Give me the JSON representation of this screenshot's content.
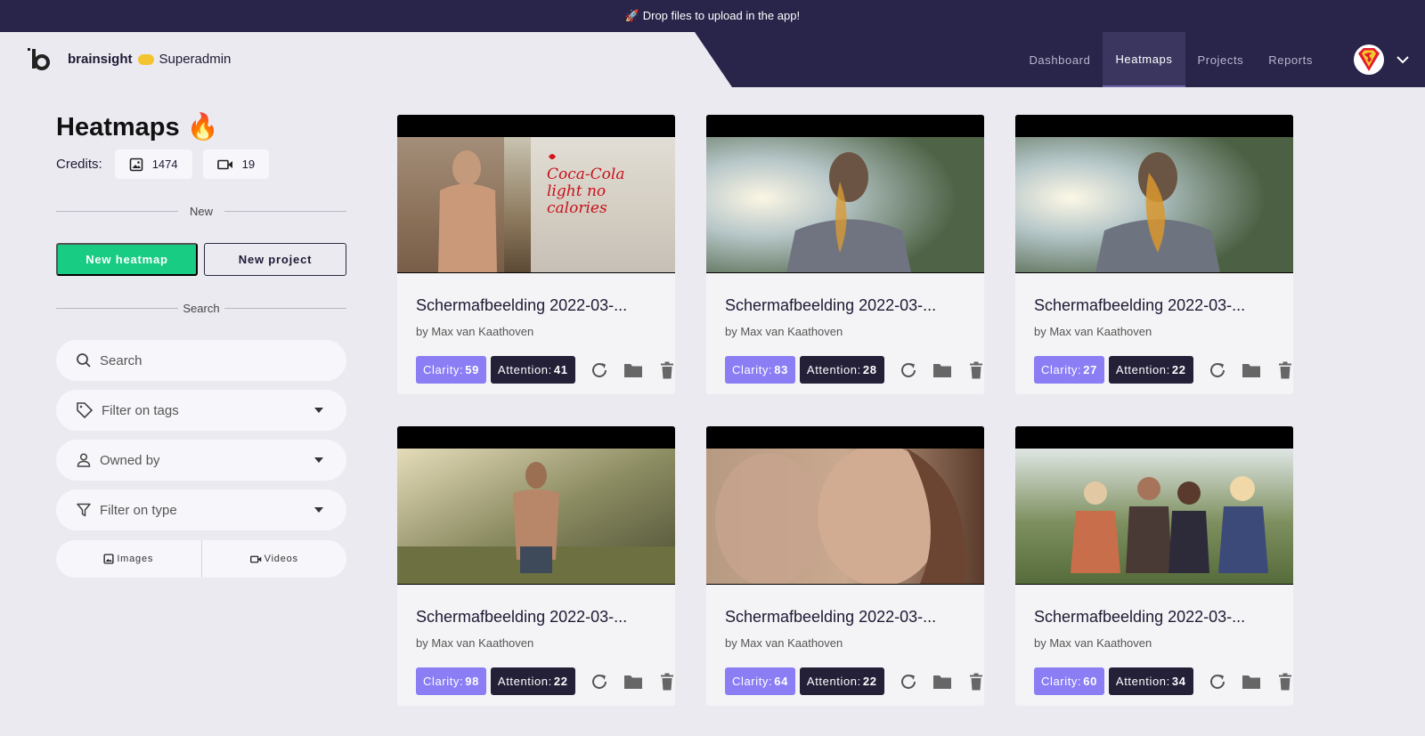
{
  "banner": {
    "text": "🚀 Drop files to upload in the app!"
  },
  "brand": {
    "name": "brainsight",
    "role": "Superadmin"
  },
  "nav": [
    {
      "label": "Dashboard",
      "active": false
    },
    {
      "label": "Heatmaps",
      "active": true
    },
    {
      "label": "Projects",
      "active": false
    },
    {
      "label": "Reports",
      "active": false
    }
  ],
  "sidebar": {
    "title": "Heatmaps",
    "title_emoji": "🔥",
    "credits_label": "Credits:",
    "image_credits": "1474",
    "video_credits": "19",
    "new_divider": "New",
    "new_heatmap_label": "New heatmap",
    "new_project_label": "New project",
    "search_divider": "Search",
    "search_placeholder": "Search",
    "filter_tags": "Filter on tags",
    "owned_by": "Owned by",
    "filter_type": "Filter on type",
    "toggle_images": "Images",
    "toggle_videos": "Videos"
  },
  "cards": [
    {
      "title": "Schermafbeelding 2022-03-...",
      "author": "by Max van Kaathoven",
      "clarity_label": "Clarity:",
      "clarity": "59",
      "attention_label": "Attention:",
      "attention": "41",
      "thumb_caption": "Coca-Cola light no calories"
    },
    {
      "title": "Schermafbeelding 2022-03-...",
      "author": "by Max van Kaathoven",
      "clarity_label": "Clarity:",
      "clarity": "83",
      "attention_label": "Attention:",
      "attention": "28"
    },
    {
      "title": "Schermafbeelding 2022-03-...",
      "author": "by Max van Kaathoven",
      "clarity_label": "Clarity:",
      "clarity": "27",
      "attention_label": "Attention:",
      "attention": "22"
    },
    {
      "title": "Schermafbeelding 2022-03-...",
      "author": "by Max van Kaathoven",
      "clarity_label": "Clarity:",
      "clarity": "98",
      "attention_label": "Attention:",
      "attention": "22"
    },
    {
      "title": "Schermafbeelding 2022-03-...",
      "author": "by Max van Kaathoven",
      "clarity_label": "Clarity:",
      "clarity": "64",
      "attention_label": "Attention:",
      "attention": "22"
    },
    {
      "title": "Schermafbeelding 2022-03-...",
      "author": "by Max van Kaathoven",
      "clarity_label": "Clarity:",
      "clarity": "60",
      "attention_label": "Attention:",
      "attention": "34"
    }
  ],
  "colors": {
    "navy": "#28244a",
    "accent_green": "#18cc83",
    "clarity_purple": "#8b7ef5",
    "attention_dark": "#232038"
  }
}
